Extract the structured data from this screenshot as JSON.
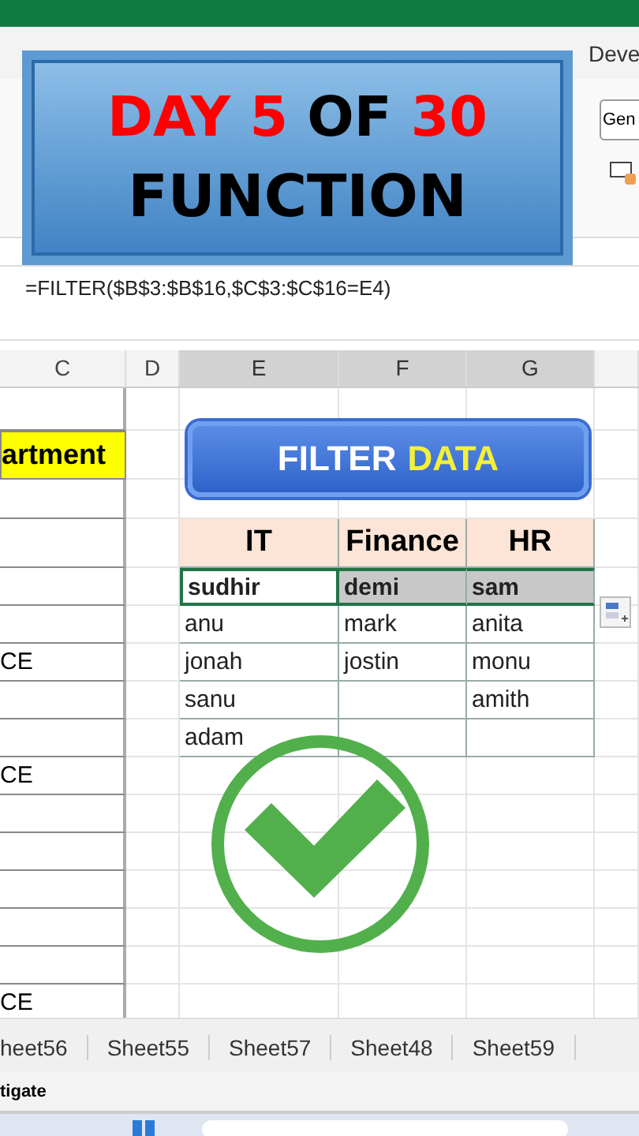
{
  "ribbon": {
    "tab_fragment": "Deve",
    "number_format": "Gen"
  },
  "banner": {
    "line1": [
      {
        "text": "DAY 5",
        "accent": true
      },
      {
        "text": "OF",
        "accent": false
      },
      {
        "text": "30",
        "accent": true
      }
    ],
    "line2": "FUNCTION"
  },
  "formula_bar": {
    "value": "=FILTER($B$3:$B$16,$C$3:$C$16=E4)"
  },
  "sheet": {
    "column_headers": [
      {
        "label": "C",
        "selected": false
      },
      {
        "label": "D",
        "selected": false
      },
      {
        "label": "E",
        "selected": true
      },
      {
        "label": "F",
        "selected": true
      },
      {
        "label": "G",
        "selected": true
      }
    ],
    "title_button": [
      {
        "text": "FILTER",
        "accent": false
      },
      {
        "text": "DATA",
        "accent": true
      }
    ],
    "rows": [
      {
        "kind": "blank"
      },
      {
        "kind": "label",
        "column_c": "artment"
      },
      {
        "kind": "blank"
      },
      {
        "kind": "table_header",
        "e": "IT",
        "f": "Finance",
        "g": "HR"
      },
      {
        "kind": "table_row",
        "selected": true,
        "e": "sudhir",
        "f": "demi",
        "g": "sam"
      },
      {
        "kind": "table_row",
        "selected": false,
        "e": "anu",
        "f": "mark",
        "g": "anita"
      },
      {
        "kind": "table_row",
        "selected": false,
        "column_c": "CE",
        "e": "jonah",
        "f": "jostin",
        "g": "monu"
      },
      {
        "kind": "table_row",
        "selected": false,
        "e": "sanu",
        "g": "amith"
      },
      {
        "kind": "table_row",
        "selected": false,
        "e": "adam"
      },
      {
        "kind": "blank",
        "column_c": "CE"
      },
      {
        "kind": "blank"
      },
      {
        "kind": "blank"
      },
      {
        "kind": "blank"
      },
      {
        "kind": "blank"
      },
      {
        "kind": "blank"
      },
      {
        "kind": "blank",
        "column_c": "CE"
      }
    ]
  },
  "sheet_tabs": [
    {
      "label": "heet56",
      "selected": false
    },
    {
      "label": "Sheet55",
      "selected": false
    },
    {
      "label": "Sheet57",
      "selected": false
    },
    {
      "label": "Sheet48",
      "selected": false
    },
    {
      "label": "Sheet59",
      "selected": false
    }
  ],
  "status_bar": {
    "text": "tigate"
  }
}
